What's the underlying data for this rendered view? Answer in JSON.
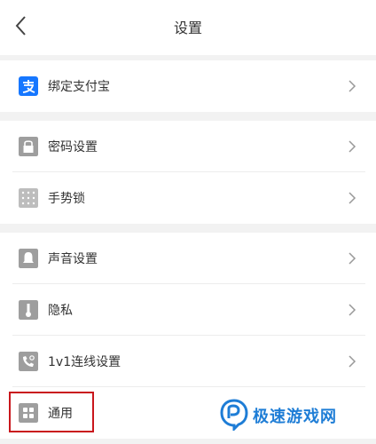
{
  "header": {
    "title": "设置"
  },
  "sections": {
    "alipay": {
      "label": "绑定支付宝"
    },
    "password": {
      "label": "密码设置"
    },
    "gesture": {
      "label": "手势锁"
    },
    "sound": {
      "label": "声音设置"
    },
    "privacy": {
      "label": "隐私"
    },
    "connect": {
      "label": "1v1连线设置"
    },
    "general": {
      "label": "通用"
    }
  },
  "watermark": {
    "text": "极速游戏网"
  },
  "colors": {
    "alipay_blue": "#1677ff",
    "icon_gray": "#9e9e9e",
    "highlight_red": "#c9161c",
    "watermark_blue": "#1e7dd6"
  },
  "icons": {
    "back": "chevron-left-icon",
    "alipay": "alipay-icon",
    "password": "lock-icon",
    "gesture": "dots-grid-icon",
    "sound": "bell-icon",
    "privacy": "thermometer-icon",
    "connect": "phone-connect-icon",
    "general": "grid-icon"
  }
}
